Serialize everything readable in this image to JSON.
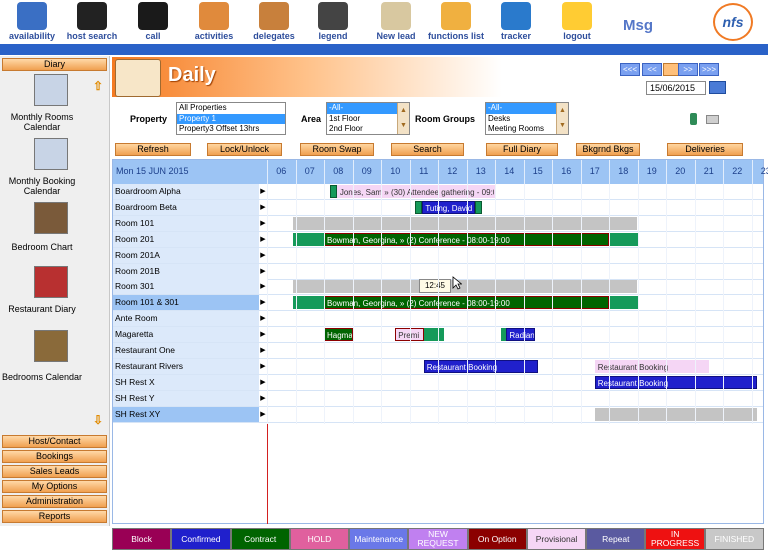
{
  "toolbar": {
    "items": [
      {
        "label": "availability",
        "icon": "availability-icon",
        "color": "#3a6fc4"
      },
      {
        "label": "host search",
        "icon": "magnifier-icon",
        "color": "#222222"
      },
      {
        "label": "call",
        "icon": "phone-icon",
        "color": "#1a1a1a"
      },
      {
        "label": "activities",
        "icon": "activities-icon",
        "color": "#e08a3c"
      },
      {
        "label": "delegates",
        "icon": "delegates-icon",
        "color": "#c8803c"
      },
      {
        "label": "legend",
        "icon": "legend-icon",
        "color": "#444444"
      },
      {
        "label": "New lead",
        "icon": "new-lead-icon",
        "color": "#d8c8a0"
      },
      {
        "label": "functions list",
        "icon": "functions-list-icon",
        "color": "#f0b040"
      },
      {
        "label": "tracker",
        "icon": "tracker-icon",
        "color": "#2a7acc"
      },
      {
        "label": "logout",
        "icon": "logout-icon",
        "color": "#ffcc33"
      }
    ],
    "msg": "Msg",
    "logo": "nfs"
  },
  "sidebar": {
    "top_tab": "Diary",
    "entries": [
      {
        "label": "Monthly Rooms Calendar",
        "icon": "calendar-grid-icon"
      },
      {
        "label": "Monthly Booking Calendar",
        "icon": "booking-calendar-icon"
      },
      {
        "label": "Bedroom Chart",
        "icon": "bedroom-icon"
      },
      {
        "label": "Restaurant Diary",
        "icon": "restaurant-icon"
      },
      {
        "label": "Bedrooms Calendar",
        "icon": "bedrooms-calendar-icon"
      }
    ],
    "bottom_tabs": [
      "Host/Contact",
      "Bookings",
      "Sales Leads",
      "My Options",
      "Administration",
      "Reports"
    ]
  },
  "header": {
    "title": "Daily",
    "nav": [
      "<<<",
      "<<",
      "",
      ">>",
      ">>>"
    ],
    "date": "15/06/2015"
  },
  "filters": {
    "property_label": "Property",
    "property_options": [
      "All Properties",
      "Property 1",
      "Property3 Offset 13hrs"
    ],
    "property_selected": 1,
    "area_label": "Area",
    "area_options": [
      "-All-",
      "1st Floor",
      "2nd Floor"
    ],
    "area_selected": 0,
    "room_groups_label": "Room Groups",
    "room_groups_options": [
      "-All-",
      "Desks",
      "Meeting Rooms"
    ],
    "room_groups_selected": 0
  },
  "actions": [
    "Refresh",
    "Lock/Unlock",
    "Room Swap",
    "Search",
    "Full Diary",
    "Bkgrnd Bkgs",
    "Deliveries"
  ],
  "grid": {
    "date_label": "Mon 15 JUN 2015",
    "hours": [
      "06",
      "07",
      "08",
      "09",
      "10",
      "11",
      "12",
      "13",
      "14",
      "15",
      "16",
      "17",
      "18",
      "19",
      "20",
      "21",
      "22",
      "23"
    ],
    "rooms": [
      {
        "name": "Boardroom Alpha",
        "highlight": false
      },
      {
        "name": "Boardroom Beta",
        "highlight": false
      },
      {
        "name": "Room 101",
        "highlight": false
      },
      {
        "name": "Room 201",
        "highlight": false
      },
      {
        "name": "Room 201A",
        "highlight": false
      },
      {
        "name": "Room 201B",
        "highlight": false
      },
      {
        "name": "Room 301",
        "highlight": false
      },
      {
        "name": "Room 101 & 301",
        "highlight": true
      },
      {
        "name": "Ante Room",
        "highlight": false
      },
      {
        "name": "Magaretta",
        "highlight": false
      },
      {
        "name": "Restaurant One",
        "highlight": false
      },
      {
        "name": "Restaurant Rivers",
        "highlight": false
      },
      {
        "name": "SH Rest X",
        "highlight": false
      },
      {
        "name": "SH Rest Y",
        "highlight": false
      },
      {
        "name": "SH Rest XY",
        "highlight": true
      }
    ],
    "bookings": [
      {
        "row": 0,
        "start": 8.2,
        "end": 8.45,
        "text": "",
        "bg": "#159a5a",
        "fg": "#ffffff",
        "border": "#0a5a30"
      },
      {
        "row": 0,
        "start": 8.45,
        "end": 14.0,
        "text": "Jones, Sam » (30) Attendee gathering - 09:0",
        "bg": "#f5d6f5",
        "fg": "#333333",
        "border": "#f5d6f5"
      },
      {
        "row": 1,
        "start": 11.2,
        "end": 11.45,
        "text": "",
        "bg": "#159a5a",
        "fg": "#ffffff",
        "border": "#0a5a30"
      },
      {
        "row": 1,
        "start": 11.45,
        "end": 13.3,
        "text": "Tuting, David",
        "bg": "#2020cc",
        "fg": "#ffffff",
        "border": "#101080"
      },
      {
        "row": 1,
        "start": 13.3,
        "end": 13.55,
        "text": "",
        "bg": "#159a5a",
        "fg": "#ffffff",
        "border": "#0a5a30"
      },
      {
        "row": 2,
        "start": 6.9,
        "end": 19.0,
        "text": "",
        "bg": "#c4c4c4",
        "fg": "#000000",
        "border": "#c4c4c4"
      },
      {
        "row": 3,
        "start": 6.9,
        "end": 8.0,
        "text": "",
        "bg": "#159a5a",
        "fg": "#ffffff",
        "border": "#159a5a"
      },
      {
        "row": 3,
        "start": 8.0,
        "end": 18.0,
        "text": "Bowman, Georgina, » (2) Conference - 08:00-19:00",
        "bg": "#006400",
        "fg": "#ffffff",
        "border": "#8b0000"
      },
      {
        "row": 3,
        "start": 18.0,
        "end": 19.0,
        "text": "",
        "bg": "#159a5a",
        "fg": "#ffffff",
        "border": "#159a5a"
      },
      {
        "row": 6,
        "start": 6.9,
        "end": 19.0,
        "text": "",
        "bg": "#c4c4c4",
        "fg": "#000000",
        "border": "#c4c4c4"
      },
      {
        "row": 7,
        "start": 6.9,
        "end": 8.0,
        "text": "",
        "bg": "#159a5a",
        "fg": "#ffffff",
        "border": "#159a5a"
      },
      {
        "row": 7,
        "start": 8.0,
        "end": 18.0,
        "text": "Bowman, Georgina, » (2) Conference - 08:00-19:00",
        "bg": "#006400",
        "fg": "#ffffff",
        "border": "#8b0000"
      },
      {
        "row": 7,
        "start": 18.0,
        "end": 19.0,
        "text": "",
        "bg": "#159a5a",
        "fg": "#ffffff",
        "border": "#159a5a"
      },
      {
        "row": 9,
        "start": 8.0,
        "end": 9.0,
        "text": "Hagma",
        "bg": "#006400",
        "fg": "#ffffff",
        "border": "#8b0000"
      },
      {
        "row": 9,
        "start": 10.5,
        "end": 11.5,
        "text": "Premi",
        "bg": "#f5d6f5",
        "fg": "#333333",
        "border": "#8b0000"
      },
      {
        "row": 9,
        "start": 11.5,
        "end": 12.2,
        "text": "",
        "bg": "#159a5a",
        "fg": "#ffffff",
        "border": "#159a5a"
      },
      {
        "row": 9,
        "start": 14.2,
        "end": 14.4,
        "text": "",
        "bg": "#159a5a",
        "fg": "#ffffff",
        "border": "#159a5a"
      },
      {
        "row": 9,
        "start": 14.4,
        "end": 15.4,
        "text": "Radian",
        "bg": "#2020cc",
        "fg": "#ffffff",
        "border": "#101080"
      },
      {
        "row": 11,
        "start": 11.5,
        "end": 15.5,
        "text": "Restaurant Booking",
        "bg": "#2020cc",
        "fg": "#ffffff",
        "border": "#101080"
      },
      {
        "row": 11,
        "start": 17.5,
        "end": 21.5,
        "text": "Restaurant Booking",
        "bg": "#f5d6f5",
        "fg": "#333333",
        "border": "#f5d6f5"
      },
      {
        "row": 12,
        "start": 17.5,
        "end": 23.2,
        "text": "Restaurant Booking",
        "bg": "#2020cc",
        "fg": "#ffffff",
        "border": "#101080"
      },
      {
        "row": 14,
        "start": 17.5,
        "end": 23.2,
        "text": "",
        "bg": "#c4c4c4",
        "fg": "#000000",
        "border": "#c4c4c4"
      }
    ],
    "tooltip": "12:45"
  },
  "legend": [
    {
      "label": "Block",
      "bg": "#990055",
      "fg": "#ffffff"
    },
    {
      "label": "Confirmed",
      "bg": "#2020cc",
      "fg": "#ffffff"
    },
    {
      "label": "Contract",
      "bg": "#006400",
      "fg": "#ffffff"
    },
    {
      "label": "HOLD",
      "bg": "#e0609e",
      "fg": "#ffffff"
    },
    {
      "label": "Maintenance",
      "bg": "#6a78e8",
      "fg": "#ffffff"
    },
    {
      "label": "NEW REQUEST",
      "bg": "#c080f0",
      "fg": "#ffffff"
    },
    {
      "label": "On Option",
      "bg": "#8b0000",
      "fg": "#ffffff"
    },
    {
      "label": "Provisional",
      "bg": "#f5d6f5",
      "fg": "#333333"
    },
    {
      "label": "Repeat",
      "bg": "#5a5aa0",
      "fg": "#ffffff"
    },
    {
      "label": "IN PROGRESS",
      "bg": "#ee1111",
      "fg": "#ffffff"
    },
    {
      "label": "FINISHED",
      "bg": "#c8c8c8",
      "fg": "#ffffff"
    }
  ]
}
